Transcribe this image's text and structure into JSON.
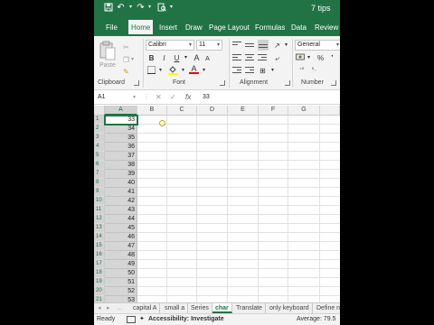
{
  "title_bar": {
    "doc_title": "7 tips"
  },
  "ribbon_tabs": [
    "File",
    "Home",
    "Insert",
    "Draw",
    "Page Layout",
    "Formulas",
    "Data",
    "Review"
  ],
  "ribbon": {
    "clipboard": {
      "paste_label": "Paste",
      "group_label": "Clipboard"
    },
    "font": {
      "font_name": "Calibri",
      "font_size": "11",
      "group_label": "Font"
    },
    "alignment": {
      "group_label": "Alignment"
    },
    "number": {
      "format": "General",
      "group_label": "Number",
      "percent_symbol": "%"
    }
  },
  "formula_bar": {
    "name_box": "A1",
    "cancel_symbol": "✕",
    "enter_symbol": "✓",
    "fx_symbol": "fx",
    "value": "33"
  },
  "columns": [
    "A",
    "B",
    "C",
    "D",
    "E",
    "F",
    "G"
  ],
  "rows": [
    {
      "n": "1",
      "a": "33"
    },
    {
      "n": "2",
      "a": "34"
    },
    {
      "n": "3",
      "a": "35"
    },
    {
      "n": "4",
      "a": "36"
    },
    {
      "n": "5",
      "a": "37"
    },
    {
      "n": "6",
      "a": "38"
    },
    {
      "n": "7",
      "a": "39"
    },
    {
      "n": "8",
      "a": "40"
    },
    {
      "n": "9",
      "a": "41"
    },
    {
      "n": "10",
      "a": "42"
    },
    {
      "n": "11",
      "a": "43"
    },
    {
      "n": "12",
      "a": "44"
    },
    {
      "n": "13",
      "a": "45"
    },
    {
      "n": "14",
      "a": "46"
    },
    {
      "n": "15",
      "a": "47"
    },
    {
      "n": "16",
      "a": "48"
    },
    {
      "n": "17",
      "a": "49"
    },
    {
      "n": "18",
      "a": "50"
    },
    {
      "n": "19",
      "a": "51"
    },
    {
      "n": "20",
      "a": "52"
    },
    {
      "n": "21",
      "a": "53"
    }
  ],
  "sheet_tabs": [
    "capital A",
    "small a",
    "Series",
    "char",
    "Translate",
    "only keyboard",
    "Define n"
  ],
  "active_sheet": "char",
  "status_bar": {
    "ready": "Ready",
    "accessibility": "Accessibility: Investigate",
    "average": "Average: 79.5"
  },
  "colors": {
    "excel_green": "#217346",
    "ribbon_bg": "#f3f3f3",
    "selection_gray": "#d5d5d5"
  }
}
